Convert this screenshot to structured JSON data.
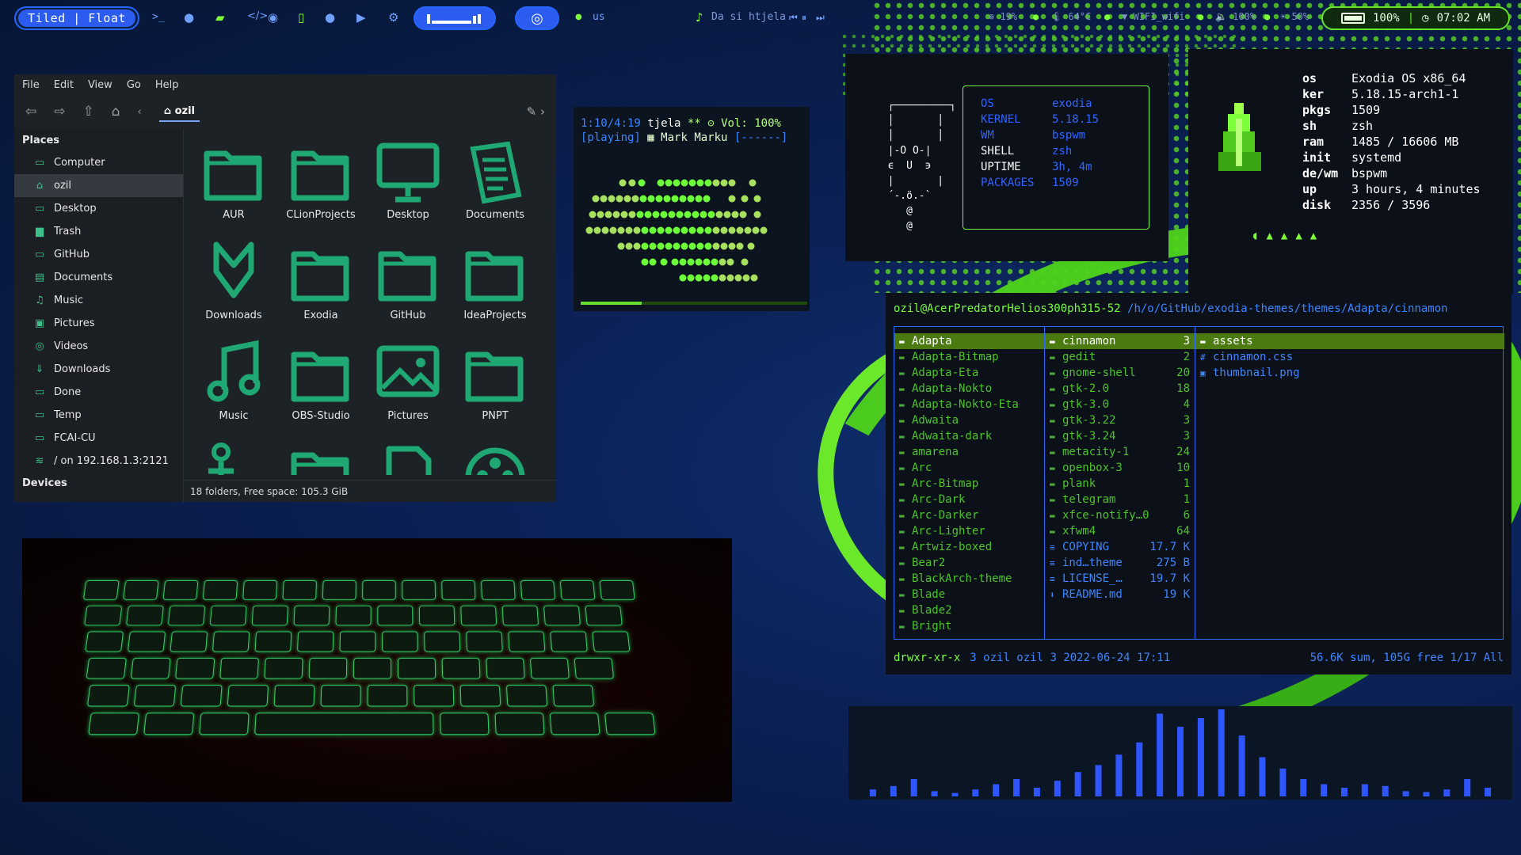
{
  "topbar": {
    "layout_label": "Tiled | Float",
    "prompt_glyph": ">_",
    "keyboard_layout": "us",
    "now_playing": "Da si htjela",
    "cpu": "19%",
    "temp": "64°C",
    "wifi": "WIFI_wifi",
    "volume": "100%",
    "brightness": "50%",
    "battery": "100%",
    "time": "07:02 AM"
  },
  "file_manager": {
    "menu": [
      "File",
      "Edit",
      "View",
      "Go",
      "Help"
    ],
    "path": "ozil",
    "places_header": "Places",
    "devices_header": "Devices",
    "places": [
      {
        "label": "Computer",
        "icon": "computer-icon"
      },
      {
        "label": "ozil",
        "icon": "home-icon"
      },
      {
        "label": "Desktop",
        "icon": "desktop-icon"
      },
      {
        "label": "Trash",
        "icon": "trash-icon"
      },
      {
        "label": "GitHub",
        "icon": "folder-icon"
      },
      {
        "label": "Documents",
        "icon": "documents-icon"
      },
      {
        "label": "Music",
        "icon": "music-icon"
      },
      {
        "label": "Pictures",
        "icon": "pictures-icon"
      },
      {
        "label": "Videos",
        "icon": "videos-icon"
      },
      {
        "label": "Downloads",
        "icon": "downloads-icon"
      },
      {
        "label": "Done",
        "icon": "folder-icon"
      },
      {
        "label": "Temp",
        "icon": "folder-icon"
      },
      {
        "label": "FCAI-CU",
        "icon": "folder-icon"
      },
      {
        "label": "/ on 192.168.1.3:2121",
        "icon": "network-icon"
      }
    ],
    "folders": [
      {
        "label": "AUR",
        "icon": "folder"
      },
      {
        "label": "CLionProjects",
        "icon": "folder"
      },
      {
        "label": "Desktop",
        "icon": "desktop"
      },
      {
        "label": "Documents",
        "icon": "documents"
      },
      {
        "label": "Downloads",
        "icon": "downloads"
      },
      {
        "label": "Exodia",
        "icon": "folder"
      },
      {
        "label": "GitHub",
        "icon": "folder"
      },
      {
        "label": "IdeaProjects",
        "icon": "folder"
      },
      {
        "label": "Music",
        "icon": "music"
      },
      {
        "label": "OBS-Studio",
        "icon": "folder"
      },
      {
        "label": "Pictures",
        "icon": "pictures"
      },
      {
        "label": "PNPT",
        "icon": "folder"
      },
      {
        "label": "",
        "icon": "person"
      },
      {
        "label": "",
        "icon": "folder"
      },
      {
        "label": "",
        "icon": "file"
      },
      {
        "label": "",
        "icon": "film"
      }
    ],
    "status": "18 folders, Free space: 105.3 GiB"
  },
  "music_player": {
    "time": "1:10/4:19",
    "track_word": "tjela",
    "marks": "**",
    "volume": "Vol: 100%",
    "state": "[playing]",
    "artist": "Mark Marku",
    "flags": "[------]",
    "progress": 0.27
  },
  "neofetch_small": {
    "art": "  ┌─────────┐\n  │       │\n  │       │\n  |-O O-|\n  ϵ  U  ϶\n  |       |\n  ´-.ö.-`\n     @\n     @",
    "rows": [
      {
        "key": "OS",
        "value": "exodia"
      },
      {
        "key": "KERNEL",
        "value": "5.18.15"
      },
      {
        "key": "WM",
        "value": "bspwm"
      },
      {
        "key": "SHELL",
        "value": "zsh"
      },
      {
        "key": "UPTIME",
        "value": "3h, 4m"
      },
      {
        "key": "PACKAGES",
        "value": "1509"
      }
    ]
  },
  "neofetch_big": {
    "rows": [
      {
        "key": "os",
        "value": "Exodia OS x86_64"
      },
      {
        "key": "ker",
        "value": "5.18.15-arch1-1"
      },
      {
        "key": "pkgs",
        "value": "1509"
      },
      {
        "key": "sh",
        "value": "zsh"
      },
      {
        "key": "ram",
        "value": "1485 / 16606 MB"
      },
      {
        "key": "init",
        "value": "systemd"
      },
      {
        "key": "de/wm",
        "value": "bspwm"
      },
      {
        "key": "up",
        "value": "3 hours, 4 minutes"
      },
      {
        "key": "disk",
        "value": "2356 / 3596"
      }
    ]
  },
  "terminal": {
    "user_host": "ozil@AcerPredatorHelios300ph315-52",
    "path": "/h/o/GitHub/exodia-themes/themes/Adapta/cinnamon",
    "col1": [
      "Adapta",
      "Adapta-Bitmap",
      "Adapta-Eta",
      "Adapta-Nokto",
      "Adapta-Nokto-Eta",
      "Adwaita",
      "Adwaita-dark",
      "amarena",
      "Arc",
      "Arc-Bitmap",
      "Arc-Dark",
      "Arc-Darker",
      "Arc-Lighter",
      "Artwiz-boxed",
      "Bear2",
      "BlackArch-theme",
      "Blade",
      "Blade2",
      "Bright"
    ],
    "col2": [
      {
        "name": "cinnamon",
        "size": "3",
        "type": "dir"
      },
      {
        "name": "gedit",
        "size": "2",
        "type": "dir"
      },
      {
        "name": "gnome-shell",
        "size": "20",
        "type": "dir"
      },
      {
        "name": "gtk-2.0",
        "size": "18",
        "type": "dir"
      },
      {
        "name": "gtk-3.0",
        "size": "4",
        "type": "dir"
      },
      {
        "name": "gtk-3.22",
        "size": "3",
        "type": "dir"
      },
      {
        "name": "gtk-3.24",
        "size": "3",
        "type": "dir"
      },
      {
        "name": "metacity-1",
        "size": "24",
        "type": "dir"
      },
      {
        "name": "openbox-3",
        "size": "10",
        "type": "dir"
      },
      {
        "name": "plank",
        "size": "1",
        "type": "dir"
      },
      {
        "name": "telegram",
        "size": "1",
        "type": "dir"
      },
      {
        "name": "xfce-notify…0",
        "size": "6",
        "type": "dir"
      },
      {
        "name": "xfwm4",
        "size": "64",
        "type": "dir"
      },
      {
        "name": "COPYING",
        "size": "17.7 K",
        "type": "file"
      },
      {
        "name": "ind…theme",
        "size": "275 B",
        "type": "file"
      },
      {
        "name": "LICENSE_…",
        "size": "19.7 K",
        "type": "file"
      },
      {
        "name": "README.md",
        "size": "19 K",
        "type": "file"
      }
    ],
    "col3": [
      {
        "name": "assets",
        "type": "dir"
      },
      {
        "name": "cinnamon.css",
        "type": "file"
      },
      {
        "name": "thumbnail.png",
        "type": "file"
      }
    ],
    "footer_perm": "drwxr-xr-x",
    "footer_info": "3 ozil ozil 3 2022-06-24 17:11",
    "footer_right": "56.6K sum, 105G free  1/17  All"
  },
  "visualizer": {
    "levels": [
      0.08,
      0.12,
      0.2,
      0.06,
      0.04,
      0.08,
      0.14,
      0.2,
      0.1,
      0.18,
      0.28,
      0.36,
      0.48,
      0.62,
      0.95,
      0.8,
      0.9,
      1.0,
      0.7,
      0.45,
      0.32,
      0.2,
      0.14,
      0.1,
      0.14,
      0.12,
      0.06,
      0.05,
      0.08,
      0.2,
      0.1
    ],
    "color": "#2e55ff"
  },
  "colors": {
    "accent_green": "#62e02a",
    "accent_blue": "#2c5bf0"
  }
}
